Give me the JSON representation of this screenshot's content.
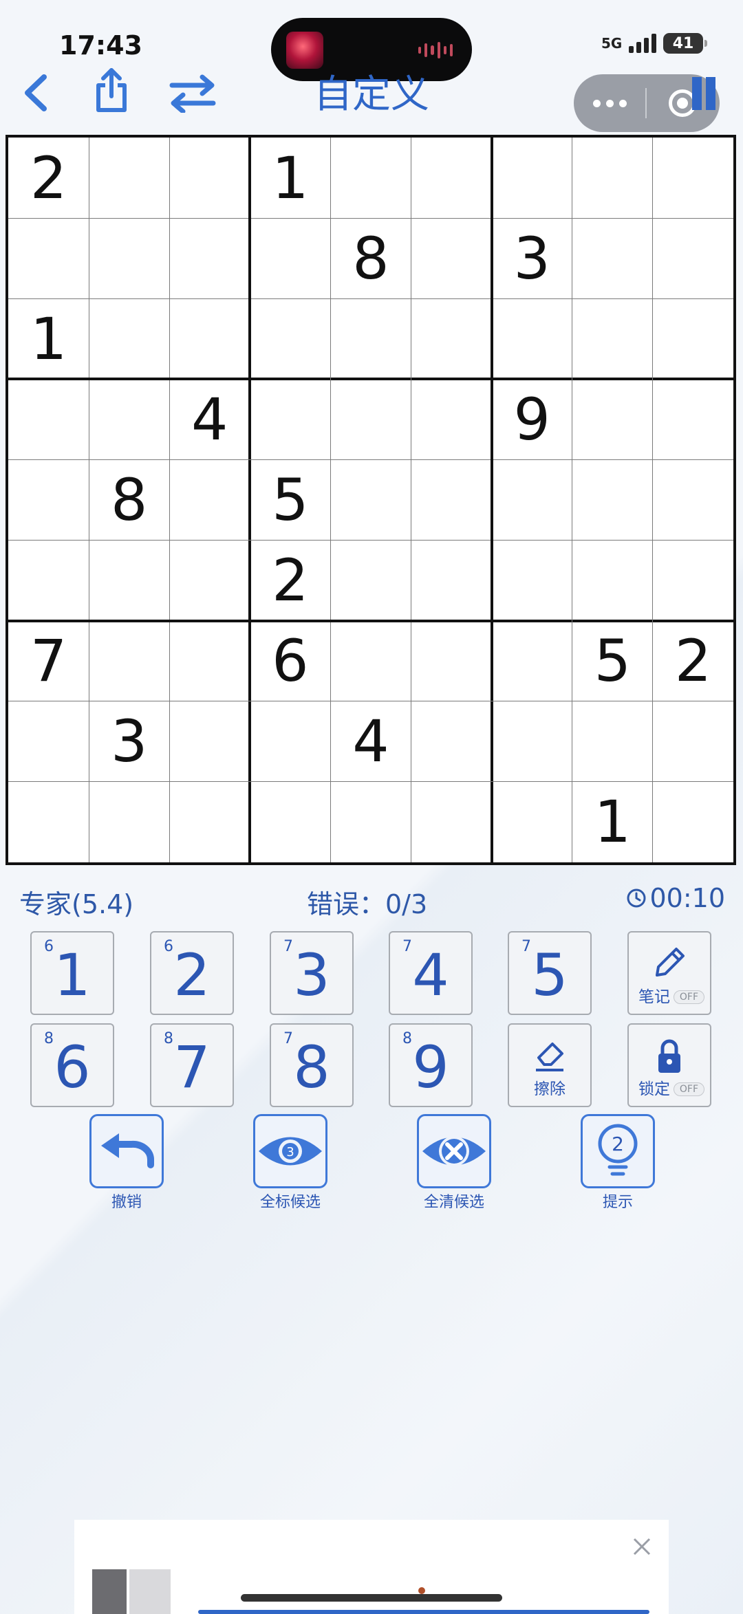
{
  "status": {
    "time": "17:43",
    "network": "5G",
    "battery": "41"
  },
  "nav": {
    "title": "自定义"
  },
  "grid": {
    "cells": [
      [
        "2",
        "",
        "",
        "1",
        "",
        "",
        "",
        "",
        ""
      ],
      [
        "",
        "",
        "",
        "",
        "8",
        "",
        "3",
        "",
        ""
      ],
      [
        "1",
        "",
        "",
        "",
        "",
        "",
        "",
        "",
        ""
      ],
      [
        "",
        "",
        "4",
        "",
        "",
        "",
        "9",
        "",
        ""
      ],
      [
        "",
        "8",
        "",
        "5",
        "",
        "",
        "",
        "",
        ""
      ],
      [
        "",
        "",
        "",
        "2",
        "",
        "",
        "",
        "",
        ""
      ],
      [
        "7",
        "",
        "",
        "6",
        "",
        "",
        "",
        "5",
        "2"
      ],
      [
        "",
        "3",
        "",
        "",
        "4",
        "",
        "",
        "",
        ""
      ],
      [
        "",
        "",
        "",
        "",
        "",
        "",
        "",
        "1",
        ""
      ]
    ]
  },
  "info": {
    "level": "专家(5.4)",
    "errors": "错误：0/3",
    "timer": "00:10"
  },
  "keypad": {
    "keys": [
      {
        "digit": "1",
        "count": "6"
      },
      {
        "digit": "2",
        "count": "6"
      },
      {
        "digit": "3",
        "count": "7"
      },
      {
        "digit": "4",
        "count": "7"
      },
      {
        "digit": "5",
        "count": "7"
      },
      {
        "digit": "6",
        "count": "8"
      },
      {
        "digit": "7",
        "count": "8"
      },
      {
        "digit": "8",
        "count": "7"
      },
      {
        "digit": "9",
        "count": "8"
      }
    ],
    "notes": {
      "label": "笔记",
      "state": "OFF"
    },
    "erase": {
      "label": "擦除"
    },
    "lock": {
      "label": "锁定",
      "state": "OFF"
    }
  },
  "actions": {
    "undo": "撤销",
    "mark_all": {
      "label": "全标候选",
      "badge": "3"
    },
    "clear_all": "全清候选",
    "hint": {
      "label": "提示",
      "badge": "2"
    }
  },
  "colors": {
    "accent": "#2f66c7",
    "grid_line": "#111111"
  }
}
